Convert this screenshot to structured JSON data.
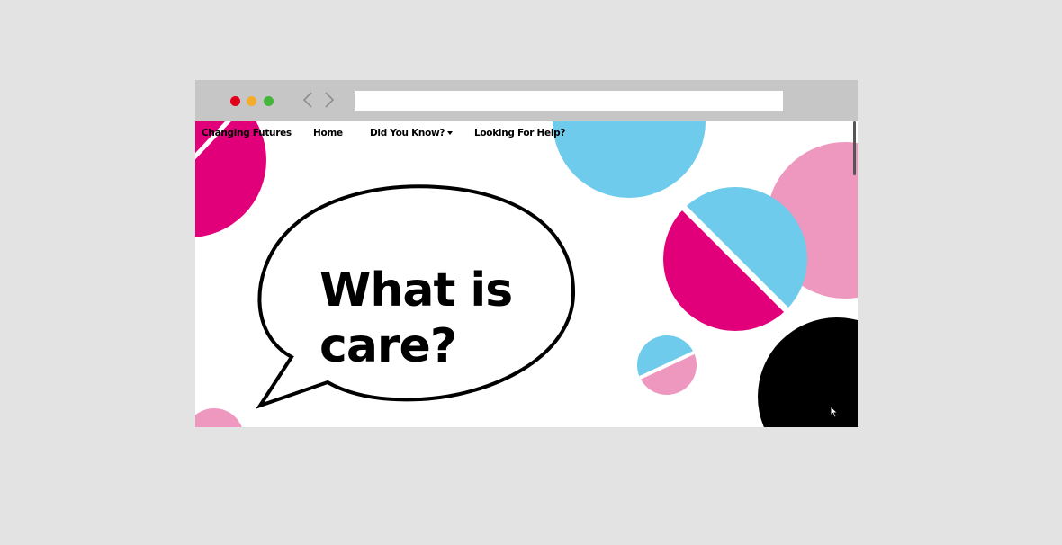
{
  "browser": {
    "url": "",
    "back_icon": "chevron-left-icon",
    "forward_icon": "chevron-right-icon",
    "traffic_lights": [
      "#e3001a",
      "#f4ad2a",
      "#43b53b"
    ]
  },
  "nav": {
    "brand": "Changing Futures",
    "items": [
      {
        "label": "Home"
      },
      {
        "label": "Did You Know?",
        "has_dropdown": true
      },
      {
        "label": "Looking For Help?"
      }
    ]
  },
  "hero": {
    "line1": "What is",
    "line2": "care?"
  },
  "colors": {
    "magenta": "#e2007a",
    "blue": "#6ecbec",
    "pink": "#ee98c0",
    "black": "#000000"
  }
}
